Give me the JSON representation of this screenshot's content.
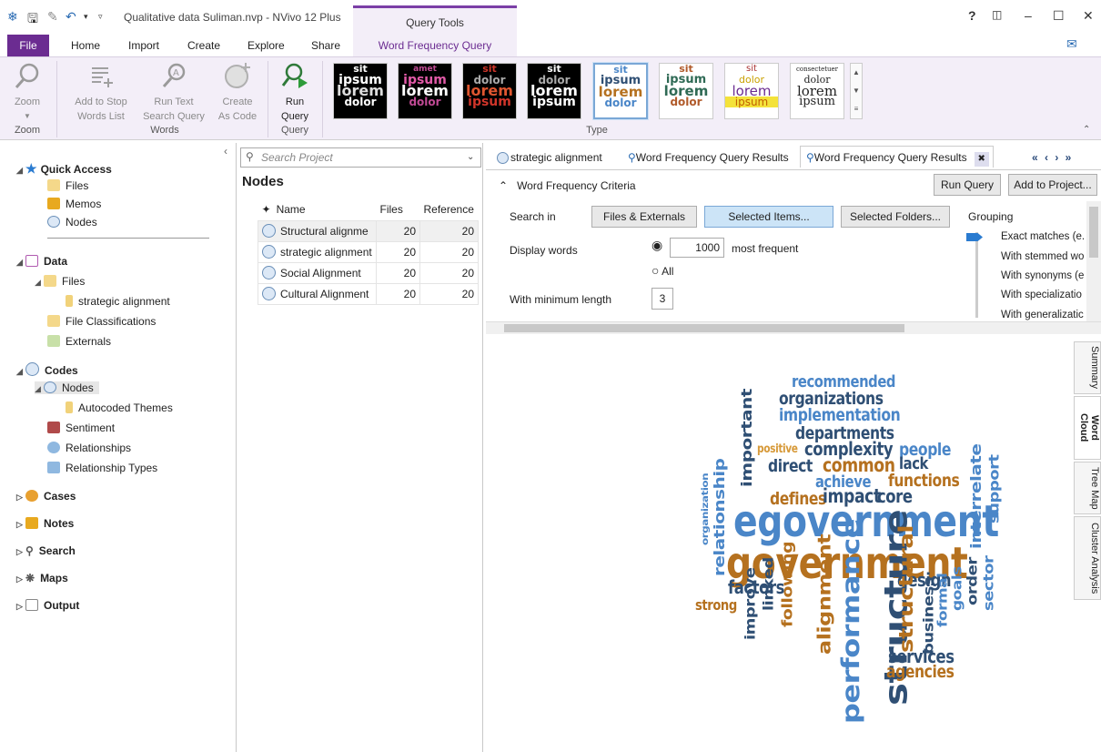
{
  "app": {
    "title": "Qualitative data Suliman.nvp - NVivo 12 Plus",
    "context_tab_group": "Query Tools",
    "help": "?",
    "feedback_icon": "chat-icon"
  },
  "ribbon_tabs": [
    "File",
    "Home",
    "Import",
    "Create",
    "Explore",
    "Share",
    "Word Frequency Query"
  ],
  "ribbon": {
    "zoom": {
      "label": "Zoom",
      "group": "Zoom"
    },
    "add_stop": {
      "line1": "Add to Stop",
      "line2": "Words List"
    },
    "run_text": {
      "line1": "Run Text",
      "line2": "Search Query"
    },
    "create_code": {
      "line1": "Create",
      "line2": "As Code"
    },
    "words_group": "Words",
    "run_query": {
      "line1": "Run",
      "line2": "Query"
    },
    "query_group": "Query",
    "type_group": "Type",
    "thumbs": [
      {
        "w1": "sit",
        "w2": "ipsum",
        "w3": "lorem",
        "w4": "dolor"
      },
      {
        "w1": "amet",
        "w2": "ipsum",
        "w3": "lorem",
        "w4": "dolor"
      },
      {
        "w1": "sit",
        "w2": "dolor",
        "w3": "lorem",
        "w4": "ipsum"
      },
      {
        "w1": "sit",
        "w2": "dolor",
        "w3": "lorem",
        "w4": "ipsum"
      },
      {
        "w1": "sit",
        "w2": "ipsum",
        "w3": "lorem",
        "w4": "dolor"
      },
      {
        "w1": "sit",
        "w2": "ipsum",
        "w3": "lorem",
        "w4": "dolor"
      },
      {
        "w1": "sit",
        "w2": "dolor",
        "w3": "lorem",
        "w4": "ipsum"
      },
      {
        "w1": "consectetuer",
        "w2": "dolor",
        "w3": "lorem",
        "w4": "ipsum"
      }
    ]
  },
  "nav": {
    "quick_access": "Quick Access",
    "qa_files": "Files",
    "qa_memos": "Memos",
    "qa_nodes": "Nodes",
    "data": "Data",
    "data_files": "Files",
    "data_file_item": "strategic alignment",
    "file_class": "File Classifications",
    "externals": "Externals",
    "codes": "Codes",
    "codes_nodes": "Nodes",
    "autocoded": "Autocoded Themes",
    "sentiment": "Sentiment",
    "relationships": "Relationships",
    "rel_types": "Relationship Types",
    "cases": "Cases",
    "notes": "Notes",
    "search": "Search",
    "maps": "Maps",
    "output": "Output"
  },
  "list": {
    "search_placeholder": "Search Project",
    "heading": "Nodes",
    "col_name": "Name",
    "col_files": "Files",
    "col_refs": "Reference",
    "rows": [
      {
        "name": "Structural alignme",
        "files": "20",
        "refs": "20"
      },
      {
        "name": "strategic alignment",
        "files": "20",
        "refs": "20"
      },
      {
        "name": "Social Alignment",
        "files": "20",
        "refs": "20"
      },
      {
        "name": "Cultural Alignment",
        "files": "20",
        "refs": "20"
      }
    ]
  },
  "detail": {
    "tabs": [
      "strategic alignment",
      "Word Frequency Query Results",
      "Word Frequency Query Results"
    ],
    "criteria": "Word Frequency Criteria",
    "run_query": "Run Query",
    "add_to_project": "Add to Project...",
    "search_in": "Search in",
    "files_externals": "Files & Externals",
    "selected_items": "Selected Items...",
    "selected_folders": "Selected Folders...",
    "grouping": "Grouping",
    "display_words": "Display words",
    "count": "1000",
    "most_frequent": "most frequent",
    "all": "All",
    "min_length_label": "With minimum length",
    "min_length": "3",
    "group_options": [
      "Exact matches (e.",
      "With stemmed wo",
      "With synonyms (e",
      "With specializatio",
      "With generalizatic"
    ],
    "side_tabs": [
      "Summary",
      "Word Cloud",
      "Tree Map",
      "Cluster Analysis"
    ]
  },
  "colors": {
    "accent": "#6b2c91",
    "blue_dark": "#2f4f74",
    "blue_light": "#4a86c8",
    "orange": "#b5711f"
  },
  "cloud": [
    {
      "t": "recommended",
      "c": "#4a86c8"
    },
    {
      "t": "organizations",
      "c": "#2f4f74"
    },
    {
      "t": "implementation",
      "c": "#4a86c8"
    },
    {
      "t": "departments",
      "c": "#2f4f74"
    },
    {
      "t": "positive",
      "c": "#d79a3a"
    },
    {
      "t": "complexity",
      "c": "#2f4f74"
    },
    {
      "t": "people",
      "c": "#4a86c8"
    },
    {
      "t": "direct",
      "c": "#2f4f74"
    },
    {
      "t": "common",
      "c": "#b5711f"
    },
    {
      "t": "lack",
      "c": "#2f4f74"
    },
    {
      "t": "achieve",
      "c": "#4a86c8"
    },
    {
      "t": "functions",
      "c": "#b5711f"
    },
    {
      "t": "defines",
      "c": "#b5711f"
    },
    {
      "t": "impact",
      "c": "#2f4f74"
    },
    {
      "t": "core",
      "c": "#2f4f74"
    },
    {
      "t": "important",
      "c": "#2f4f74"
    },
    {
      "t": "egovernment",
      "c": "#4a86c8"
    },
    {
      "t": "government",
      "c": "#b5711f"
    },
    {
      "t": "relationship",
      "c": "#4a86c8"
    },
    {
      "t": "organization",
      "c": "#4a86c8"
    },
    {
      "t": "interrelate",
      "c": "#4a86c8"
    },
    {
      "t": "support",
      "c": "#4a86c8"
    },
    {
      "t": "factors",
      "c": "#2f4f74"
    },
    {
      "t": "design",
      "c": "#2f4f74"
    },
    {
      "t": "strong",
      "c": "#b5711f"
    },
    {
      "t": "linked",
      "c": "#2f4f74"
    },
    {
      "t": "following",
      "c": "#b5711f"
    },
    {
      "t": "improve",
      "c": "#2f4f74"
    },
    {
      "t": "alignment",
      "c": "#b5711f"
    },
    {
      "t": "performance",
      "c": "#4a86c8"
    },
    {
      "t": "structure",
      "c": "#2f4f74"
    },
    {
      "t": "structural",
      "c": "#b5711f"
    },
    {
      "t": "business",
      "c": "#2f4f74"
    },
    {
      "t": "formal",
      "c": "#4a86c8"
    },
    {
      "t": "goals",
      "c": "#4a86c8"
    },
    {
      "t": "order",
      "c": "#2f4f74"
    },
    {
      "t": "sector",
      "c": "#4a86c8"
    },
    {
      "t": "services",
      "c": "#2f4f74"
    },
    {
      "t": "agencies",
      "c": "#b5711f"
    }
  ]
}
